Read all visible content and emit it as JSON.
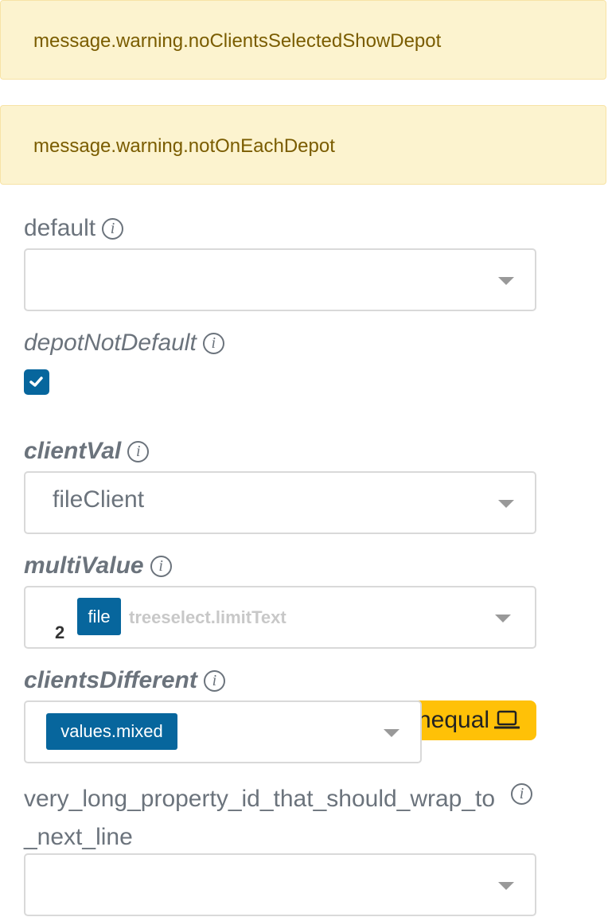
{
  "alerts": {
    "no_clients": "message.warning.noClientsSelectedShowDepot",
    "not_on_each_depot": "message.warning.notOnEachDepot"
  },
  "fields": {
    "default": {
      "label": "default",
      "value": ""
    },
    "depot_not_default": {
      "label": "depotNotDefault",
      "checked": true
    },
    "client_val": {
      "label": "clientVal",
      "value": "fileClient"
    },
    "multi_value": {
      "label": "multiValue",
      "count": "2",
      "chip": "file",
      "limit_text": "treeselect.limitText"
    },
    "clients_different": {
      "label": "clientsDifferent",
      "chip": "values.mixed",
      "badge": "nequal"
    },
    "long_property": {
      "label": "very_long_property_id_that_should_wrap_to_next_line",
      "value": ""
    }
  },
  "icons": {
    "info": "info-icon",
    "arrow": "chevron-down-icon",
    "check": "check-icon",
    "laptop": "laptop-icon"
  },
  "colors": {
    "primary": "#07669d",
    "warning_bg": "#fcf3cf",
    "warning_text": "#7a5c00",
    "badge": "#ffc107"
  }
}
